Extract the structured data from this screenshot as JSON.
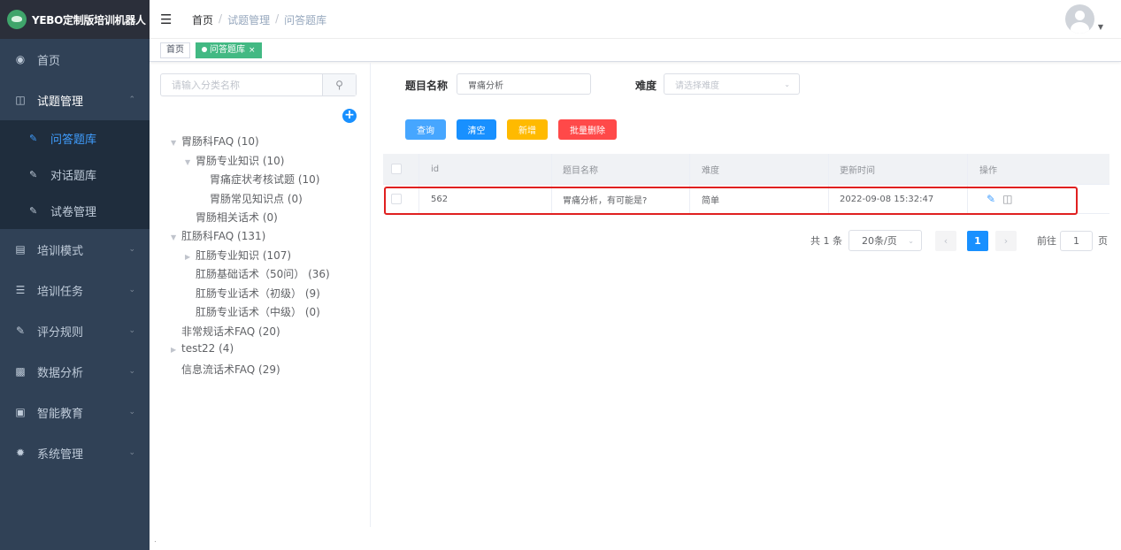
{
  "app": {
    "title": "YEBO定制版培训机器人"
  },
  "sidebar": {
    "home": "首页",
    "exam": {
      "label": "试题管理",
      "children": [
        {
          "label": "问答题库"
        },
        {
          "label": "对话题库"
        },
        {
          "label": "试卷管理"
        }
      ]
    },
    "items": [
      {
        "label": "培训模式"
      },
      {
        "label": "培训任务"
      },
      {
        "label": "评分规则"
      },
      {
        "label": "数据分析"
      },
      {
        "label": "智能教育"
      },
      {
        "label": "系统管理"
      }
    ]
  },
  "header": {
    "breadcrumb": [
      "首页",
      "试题管理",
      "问答题库"
    ],
    "separator": "/"
  },
  "tags": [
    {
      "label": "首页"
    },
    {
      "label": "问答题库",
      "close": "×"
    }
  ],
  "tree": {
    "search_placeholder": "请输入分类名称",
    "nodes": [
      "胃肠科FAQ (10)",
      "胃肠专业知识 (10)",
      "胃痛症状考核试题 (10)",
      "胃肠常见知识点 (0)",
      "胃肠相关话术 (0)",
      "肛肠科FAQ (131)",
      "肛肠专业知识 (107)",
      "肛肠基础话术（50问） (36)",
      "肛肠专业话术（初级） (9)",
      "肛肠专业话术（中级） (0)",
      "非常规话术FAQ (20)",
      "test22 (4)",
      "信息流话术FAQ (29)"
    ]
  },
  "filters": {
    "name_label": "题目名称",
    "name_value": "胃痛分析",
    "difficulty_label": "难度",
    "difficulty_placeholder": "请选择难度"
  },
  "buttons": {
    "query": "查询",
    "clear": "清空",
    "add": "新增",
    "batch_delete": "批量删除"
  },
  "colors": {
    "query": "#46a6ff",
    "clear": "#1890ff",
    "add": "#ffba00",
    "batch_delete": "#ff4949"
  },
  "table": {
    "columns": [
      "id",
      "题目名称",
      "难度",
      "更新时间",
      "操作"
    ],
    "rows": [
      {
        "id": "562",
        "name": "胃痛分析，有可能是?",
        "difficulty": "简单",
        "updated": "2022-09-08 15:32:47"
      }
    ]
  },
  "pagination": {
    "total": "共 1 条",
    "page_size": "20条/页",
    "current": "1",
    "goto_prefix": "前往",
    "goto_value": "1",
    "goto_suffix": "页"
  }
}
